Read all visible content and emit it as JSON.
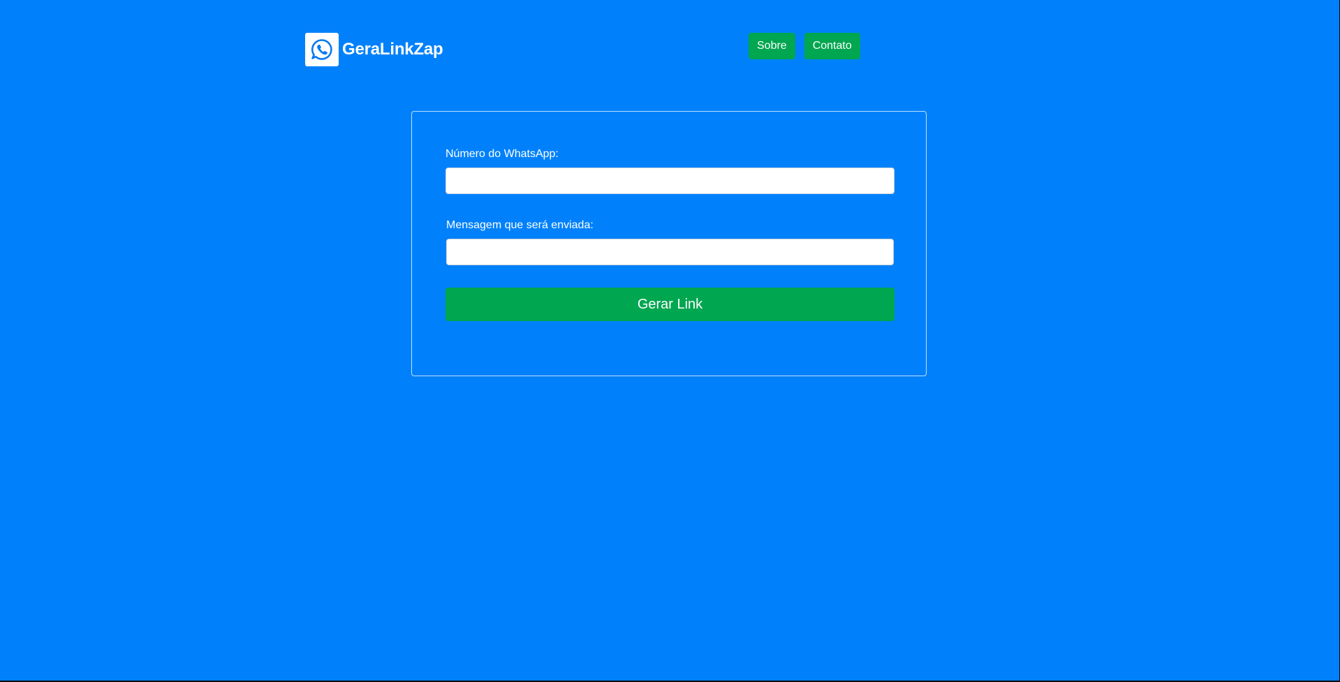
{
  "header": {
    "brand_name": "GeraLinkZap",
    "logo_icon": "whatsapp-icon",
    "nav": {
      "about_label": "Sobre",
      "contact_label": "Contato"
    }
  },
  "form": {
    "phone": {
      "label": "Número do WhatsApp:",
      "value": "",
      "placeholder": ""
    },
    "message": {
      "label": "Mensagem que será enviada:",
      "value": "",
      "placeholder": ""
    },
    "submit_label": "Gerar Link"
  },
  "colors": {
    "background": "#0081fb",
    "button": "#00a650",
    "text": "#ffffff"
  }
}
